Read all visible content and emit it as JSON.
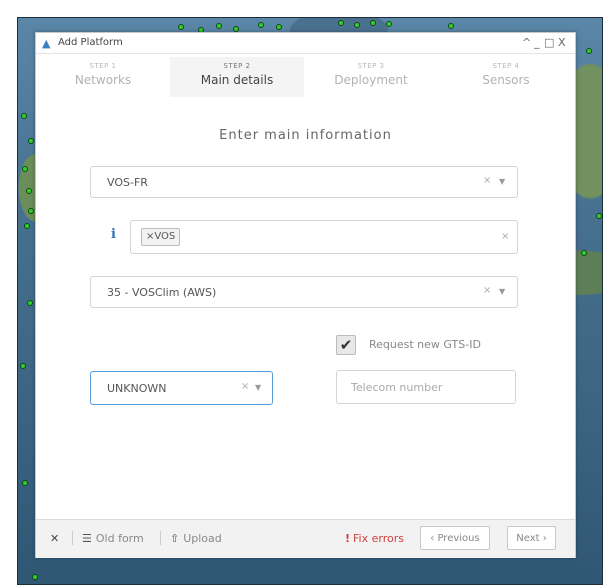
{
  "window": {
    "title": "Add Platform",
    "controls": [
      "^",
      "_",
      "□",
      "X"
    ]
  },
  "steps": [
    {
      "number": "STEP 1",
      "label": "Networks",
      "active": false
    },
    {
      "number": "STEP 2",
      "label": "Main details",
      "active": true
    },
    {
      "number": "STEP 3",
      "label": "Deployment",
      "active": false
    },
    {
      "number": "STEP 4",
      "label": "Sensors",
      "active": false
    }
  ],
  "form": {
    "heading": "Enter main information",
    "network_select": {
      "value": "VOS-FR"
    },
    "tag_select": {
      "info_icon": "i",
      "tags": [
        "VOS"
      ]
    },
    "model_select": {
      "value": "35 - VOSClim (AWS)"
    },
    "gts_checkbox": {
      "checked": true,
      "label": "Request new GTS-ID"
    },
    "unknown_select": {
      "value": "UNKNOWN"
    },
    "telecom_input": {
      "placeholder": "Telecom number",
      "value": ""
    }
  },
  "footer": {
    "close_icon": "✕",
    "old_form_label": "Old form",
    "upload_label": "Upload",
    "fix_errors_label": "Fix errors",
    "previous_label": "Previous",
    "next_label": "Next"
  },
  "colors": {
    "accent": "#2c6fb5",
    "error": "#d04040",
    "marker": "#33cc33"
  }
}
